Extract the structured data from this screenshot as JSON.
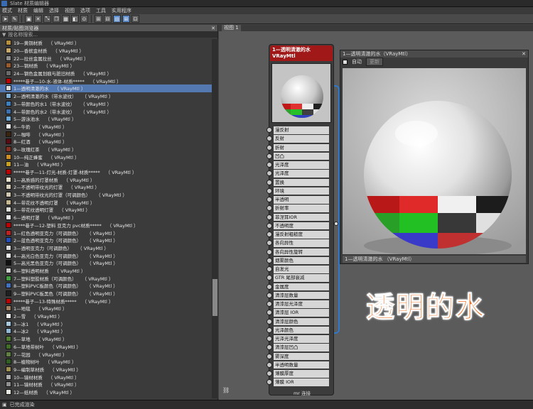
{
  "window": {
    "title": "Slate 材质编辑器"
  },
  "menubar": [
    "模式",
    "材质",
    "编辑",
    "选择",
    "视图",
    "选项",
    "工具",
    "实用程序"
  ],
  "browser": {
    "title": "材质/贴图浏览器",
    "search_placeholder": "按名称搜索...",
    "items": [
      {
        "name": "19—黄铜材质",
        "type": "（ VRayMtl ）",
        "color": "#b8903a"
      },
      {
        "name": "20—香槟金材质",
        "type": "（ VRayMtl ）",
        "color": "#c9a96a"
      },
      {
        "name": "22—拉丝金属拉丝",
        "type": "（ VRayMtl ）",
        "color": "#8e8e8e"
      },
      {
        "name": "23—铜材质",
        "type": "（ VRayMtl ）",
        "color": "#9a5a2a"
      },
      {
        "name": "24—钢色金属划痕与脏旧材质",
        "type": "（ VRayMtl ）",
        "color": "#6a6a6a"
      },
      {
        "name": "*****巷子—10-水-液体-材质*****",
        "type": "（ VRayMtl ）",
        "color": "#c00000"
      },
      {
        "name": "1—透明清澈的水",
        "type": "（ VRayMtl ）",
        "color": "#d8d8d8",
        "selected": true
      },
      {
        "name": "2—透明清澈的水（带水波纹）",
        "type": "（ VRayMtl ）",
        "color": "#7fb0d8"
      },
      {
        "name": "3—带颜色的水1（带水波纹）",
        "type": "（ VRayMtl ）",
        "color": "#3a7fc0"
      },
      {
        "name": "4—带颜色的水2（带水波纹）",
        "type": "（ VRayMtl ）",
        "color": "#3a6fb0"
      },
      {
        "name": "5—游泳池水",
        "type": "（ VRayMtl ）",
        "color": "#6aaad8"
      },
      {
        "name": "6—牛奶",
        "type": "（ VRayMtl ）",
        "color": "#f0f0f0"
      },
      {
        "name": "7—咖啡",
        "type": "（ VRayMtl ）",
        "color": "#3a2410"
      },
      {
        "name": "8—红酒",
        "type": "（ VRayMtl ）",
        "color": "#5a0a10"
      },
      {
        "name": "9—玫瑰红茶",
        "type": "（ VRayMtl ）",
        "color": "#8a3020"
      },
      {
        "name": "10—纯正蜂蜜",
        "type": "（ VRayMtl ）",
        "color": "#d09020"
      },
      {
        "name": "11—油",
        "type": "（ VRayMtl ）",
        "color": "#c8a020"
      },
      {
        "name": "*****巷子—11-灯光-材质-灯罩-材质*****",
        "type": "（ VRayMtl ）",
        "color": "#c00000"
      },
      {
        "name": "1—高质感的灯罩材质",
        "type": "（ VRayMtl ）",
        "color": "#e8e0c8"
      },
      {
        "name": "2—不透明带纹光的灯罩",
        "type": "（ VRayMtl ）",
        "color": "#d8d0b8"
      },
      {
        "name": "3—不透明带纹光的灯罩（可调颜色）",
        "type": "（ VRayMtl ）",
        "color": "#d0c8b0"
      },
      {
        "name": "4—带花纹不透明灯罩",
        "type": "（ VRayMtl ）",
        "color": "#c8b890"
      },
      {
        "name": "5—带花纹透明灯罩",
        "type": "（ VRayMtl ）",
        "color": "#e0e0d8"
      },
      {
        "name": "6—透明灯罩",
        "type": "（ VRayMtl ）",
        "color": "#e8e8e8"
      },
      {
        "name": "*****巷子—12-塑料 亚克力 pvc材质*****",
        "type": "（ VRayMtl ）",
        "color": "#c00000"
      },
      {
        "name": "1—红色透明亚克力（可调颜色）",
        "type": "（ VRayMtl ）",
        "color": "#c02020"
      },
      {
        "name": "2—蓝色透明亚克力（可调颜色）",
        "type": "（ VRayMtl ）",
        "color": "#2050c0"
      },
      {
        "name": "3—透明亚克力（可调颜色）",
        "type": "（ VRayMtl ）",
        "color": "#d8d8d8"
      },
      {
        "name": "4—高光白色亚克力（可调颜色）",
        "type": "（ VRayMtl ）",
        "color": "#f0f0f0"
      },
      {
        "name": "5—高光黑色亚克力（可调颜色）",
        "type": "（ VRayMtl ）",
        "color": "#101010"
      },
      {
        "name": "6—塑料透明材质",
        "type": "（ VRayMtl ）",
        "color": "#d0d0d0"
      },
      {
        "name": "7—塑料塑胶材质（可调颜色）",
        "type": "（ VRayMtl ）",
        "color": "#40a040"
      },
      {
        "name": "8—塑料PVC板颜色（可调颜色）",
        "type": "（ VRayMtl ）",
        "color": "#4070c0"
      },
      {
        "name": "9—塑料PVC板黑色（可调颜色）",
        "type": "（ VRayMtl ）",
        "color": "#202020"
      },
      {
        "name": "*****巷子—13-特殊材质*****",
        "type": "（ VRayMtl ）",
        "color": "#c00000"
      },
      {
        "name": "1—地毯",
        "type": "（ VRayMtl ）",
        "color": "#a08060"
      },
      {
        "name": "2—雪",
        "type": "（ VRayMtl ）",
        "color": "#f0f0f0"
      },
      {
        "name": "3—冰1",
        "type": "（ VRayMtl ）",
        "color": "#a8c8e0"
      },
      {
        "name": "4—冰2",
        "type": "（ VRayMtl ）",
        "color": "#90b8d8"
      },
      {
        "name": "5—草地",
        "type": "（ VRayMtl ）",
        "color": "#508030"
      },
      {
        "name": "6—草地带树叶",
        "type": "（ VRayMtl ）",
        "color": "#407028"
      },
      {
        "name": "7—花园",
        "type": "（ VRayMtl ）",
        "color": "#608040"
      },
      {
        "name": "8—植物树叶",
        "type": "（ VRayMtl ）",
        "color": "#306020"
      },
      {
        "name": "9—编制草材质",
        "type": "（ VRayMtl ）",
        "color": "#a09050"
      },
      {
        "name": "10—镜材材质",
        "type": "（ VRayMtl ）",
        "color": "#b0b0b0"
      },
      {
        "name": "11—镜材材质",
        "type": "（ VRayMtl ）",
        "color": "#909090"
      },
      {
        "name": "12—纸材质",
        "type": "（ VRayMtl ）",
        "color": "#e8e8e0"
      }
    ]
  },
  "view": {
    "tab_label": "视图 1"
  },
  "node": {
    "title_line1": "1—透明清澈的水",
    "title_line2": "VRayMtl",
    "slots": [
      "漫反射",
      "反射",
      "折射",
      "凹凸",
      "光泽度",
      "光泽度",
      "置换",
      "环境",
      "半透明",
      "折射率",
      "菲涅耳IOR",
      "不透明度",
      "漫反射粗糙度",
      "各向异性",
      "各向异性旋转",
      "烟雾颜色",
      "自发光",
      "GTR 尾部衰减",
      "金属度",
      "清漆层数量",
      "清漆层光泽度",
      "清漆层 IOR",
      "清漆层颜色",
      "光泽颜色",
      "光泽光泽度",
      "清漆层凹凸",
      "雾深度",
      "半透明数量",
      "薄膜厚度",
      "薄膜 IOR"
    ],
    "footer": "mr 连接"
  },
  "preview": {
    "title": "1—透明清澈的水（VRayMtl）",
    "auto_label": "自动",
    "update_label": "更新",
    "footer": "1—透明清澈的水 （VRayMtl）"
  },
  "overlay_text": "透明的水",
  "status": {
    "text": "已完成渲染"
  },
  "colors": {
    "selection": "#5478b0",
    "node_header": "#a01818",
    "accent": "#f26a1b"
  }
}
